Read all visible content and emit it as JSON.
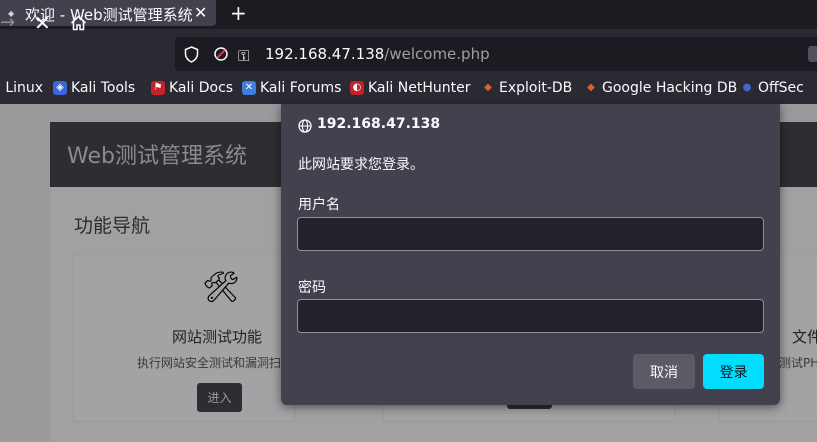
{
  "browser": {
    "tab_title": "欢迎 - Web测试管理系统",
    "tab_close": "✕",
    "new_tab": "+",
    "url_host": "192.168.47.138",
    "url_path": "/welcome.php"
  },
  "bookmarks": [
    {
      "label": "i Linux",
      "color": "#2f7fd8"
    },
    {
      "label": "Kali Tools",
      "color": "#3a66d6"
    },
    {
      "label": "Kali Docs",
      "color": "#c4222b"
    },
    {
      "label": "Kali Forums",
      "color": "#3f7de0"
    },
    {
      "label": "Kali NetHunter",
      "color": "#c4222b"
    },
    {
      "label": "Exploit-DB",
      "color": "#e0602a"
    },
    {
      "label": "Google Hacking DB",
      "color": "#e0602a"
    },
    {
      "label": "OffSec",
      "color": "#4466cc"
    }
  ],
  "page": {
    "header_title": "Web测试管理系统",
    "section_title": "功能导航",
    "feature1": {
      "title": "网站测试功能",
      "desc": "执行网站安全测试和漏洞扫描",
      "button": "进入"
    },
    "feature3": {
      "title": "文件",
      "desc": "测试PH"
    }
  },
  "dialog": {
    "host": "192.168.47.138",
    "message": "此网站要求您登录。",
    "username_label": "用户名",
    "username_value": "",
    "password_label": "密码",
    "password_value": "",
    "cancel_label": "取消",
    "login_label": "登录"
  },
  "colors": {
    "accent": "#00ddff",
    "dialog_bg": "#42414d",
    "toolbar_bg": "#2b2a33"
  }
}
